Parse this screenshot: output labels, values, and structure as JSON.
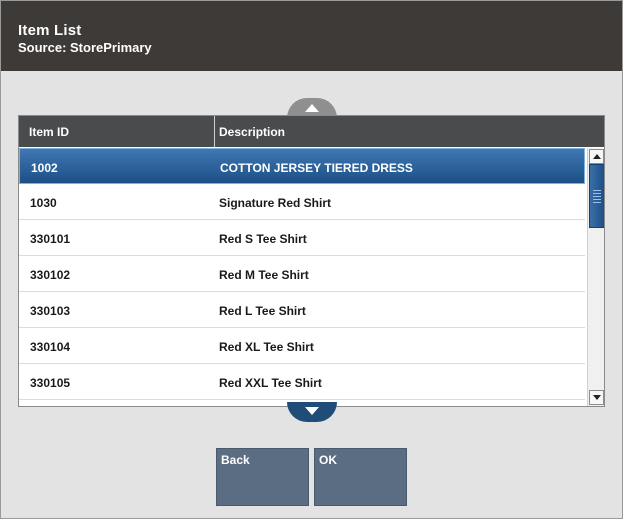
{
  "header": {
    "title": "Item List",
    "subtitle": "Source: StorePrimary"
  },
  "table": {
    "columns": [
      "Item ID",
      "Description"
    ],
    "rows": [
      {
        "id": "1002",
        "description": "COTTON JERSEY TIERED DRESS",
        "selected": true
      },
      {
        "id": "1030",
        "description": "Signature Red Shirt"
      },
      {
        "id": "330101",
        "description": "Red S Tee Shirt"
      },
      {
        "id": "330102",
        "description": "Red M Tee Shirt"
      },
      {
        "id": "330103",
        "description": "Red L Tee Shirt"
      },
      {
        "id": "330104",
        "description": "Red XL Tee Shirt"
      },
      {
        "id": "330105",
        "description": "Red XXL Tee Shirt"
      }
    ]
  },
  "buttons": {
    "back": "Back",
    "ok": "OK"
  },
  "icons": {
    "page_up": "triangle-up-icon",
    "page_down": "triangle-down-icon"
  },
  "colors": {
    "titlebar": "#3d3a37",
    "selected_row": "#2b5f97",
    "button": "#5b6d83"
  }
}
